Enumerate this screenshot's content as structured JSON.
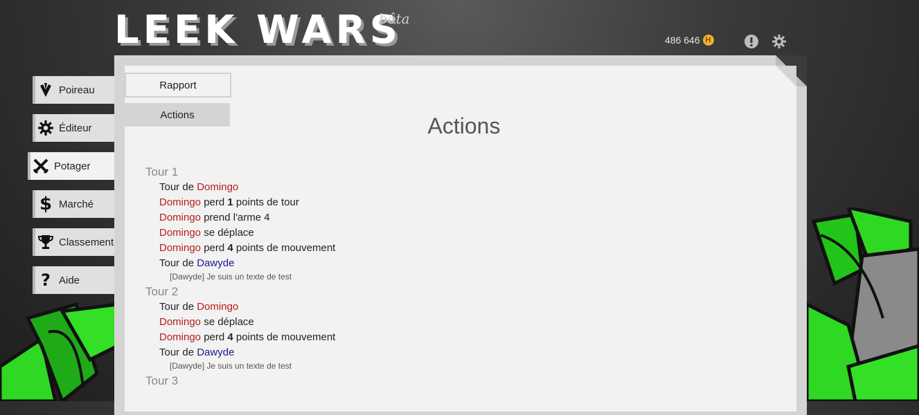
{
  "header": {
    "logo": "LEEK WARS",
    "logo_tag": "bêta",
    "habs": "486 646",
    "coin_symbol": "H"
  },
  "icons": {
    "alert": "exclamation-circle-icon",
    "settings": "gear-icon",
    "coin": "habs-coin-icon"
  },
  "menu": [
    {
      "label": "Poireau",
      "icon": "leek-icon"
    },
    {
      "label": "Éditeur",
      "icon": "gear-icon"
    },
    {
      "label": "Potager",
      "icon": "crossed-swords-icon"
    },
    {
      "label": "Marché",
      "icon": "dollar-icon"
    },
    {
      "label": "Classement",
      "icon": "trophy-icon"
    },
    {
      "label": "Aide",
      "icon": "question-icon"
    }
  ],
  "tabs": {
    "rapport": "Rapport",
    "actions": "Actions"
  },
  "page_title": "Actions",
  "log": {
    "turn_label": "Tour",
    "de": "de",
    "player1": "Domingo",
    "player2": "Dawyde",
    "t1": "Tour 1",
    "t2": "Tour 2",
    "t3": "Tour 3",
    "perd": "perd",
    "pt_tour": "points de tour",
    "pt_mvt": "points de mouvement",
    "prend": "prend l'arme 4",
    "deplace": "se déplace",
    "tour_de": "Tour de",
    "n1": "1",
    "n4": "4",
    "test_msg": "[Dawyde] Je suis un texte de test"
  },
  "colors": {
    "player1": "#b71c1c",
    "player2": "#1a1a8a",
    "accent_green": "#27d61e"
  }
}
